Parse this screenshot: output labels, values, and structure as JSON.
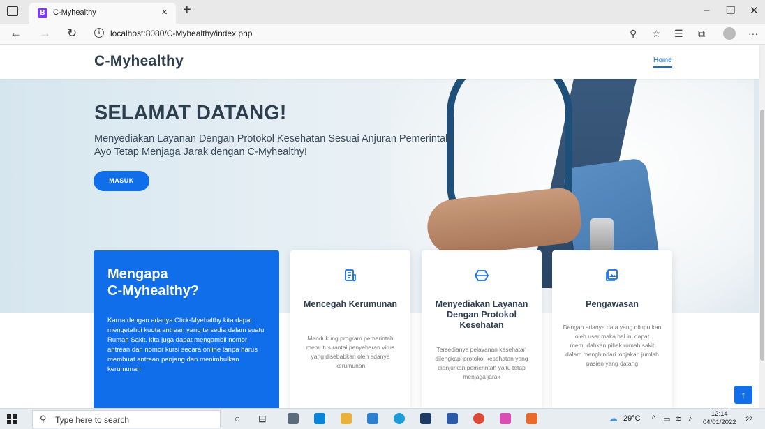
{
  "browser": {
    "tab_title": "C-Myhealthy",
    "tab_favicon": "B",
    "url": "localhost:8080/C-Myhealthy/index.php"
  },
  "site": {
    "logo": "C-Myhealthy",
    "nav_home": "Home"
  },
  "hero": {
    "title": "SELAMAT DATANG!",
    "subtitle_line1": "Menyediakan Layanan Dengan Protokol Kesehatan Sesuai Anjuran Pemerintah",
    "subtitle_line2": "Ayo Tetap Menjaga Jarak dengan C-Myhealthy!",
    "button": "MASUK"
  },
  "why": {
    "title_line1": "Mengapa",
    "title_line2": "C-Myhealthy?",
    "text": "Karna dengan adanya Click-Myehalthy kita dapat mengetahui kuota antrean yang tersedia dalam suatu Rumah Sakit. kita juga dapat mengambil nomor antrean dan nomor kursi secara online tanpa harus membuat antrean panjang dan menimbulkan kerumunan"
  },
  "cards": [
    {
      "icon": "document-list-icon",
      "title": "Mencegah Kerumunan",
      "text": "Mendukung program pemerintah memutus rantai penyebaran virus yang disebabkan oleh adanya kerumunan"
    },
    {
      "icon": "cube-icon",
      "title": "Menyediakan Layanan Dengan Protokol Kesehatan",
      "text": "Tersedianya pelayanan kesehatan dilengkapi protokol kesehatan yang dianjurkan pemerintah yaitu tetap menjaga jarak"
    },
    {
      "icon": "image-icon",
      "title": "Pengawasan",
      "text": "Dengan adanya data yang diinputkan oleh user maka hal ini dapat memudahkan pihak rumah sakit dalam menghindari lonjakan jumlah pasien yang datang"
    }
  ],
  "taskbar": {
    "search_placeholder": "Type here to search",
    "weather": "29°C",
    "time": "12:14",
    "date": "04/01/2022",
    "notifications": "22"
  },
  "colors": {
    "accent": "#106eea",
    "heading": "#2d3e4f"
  }
}
